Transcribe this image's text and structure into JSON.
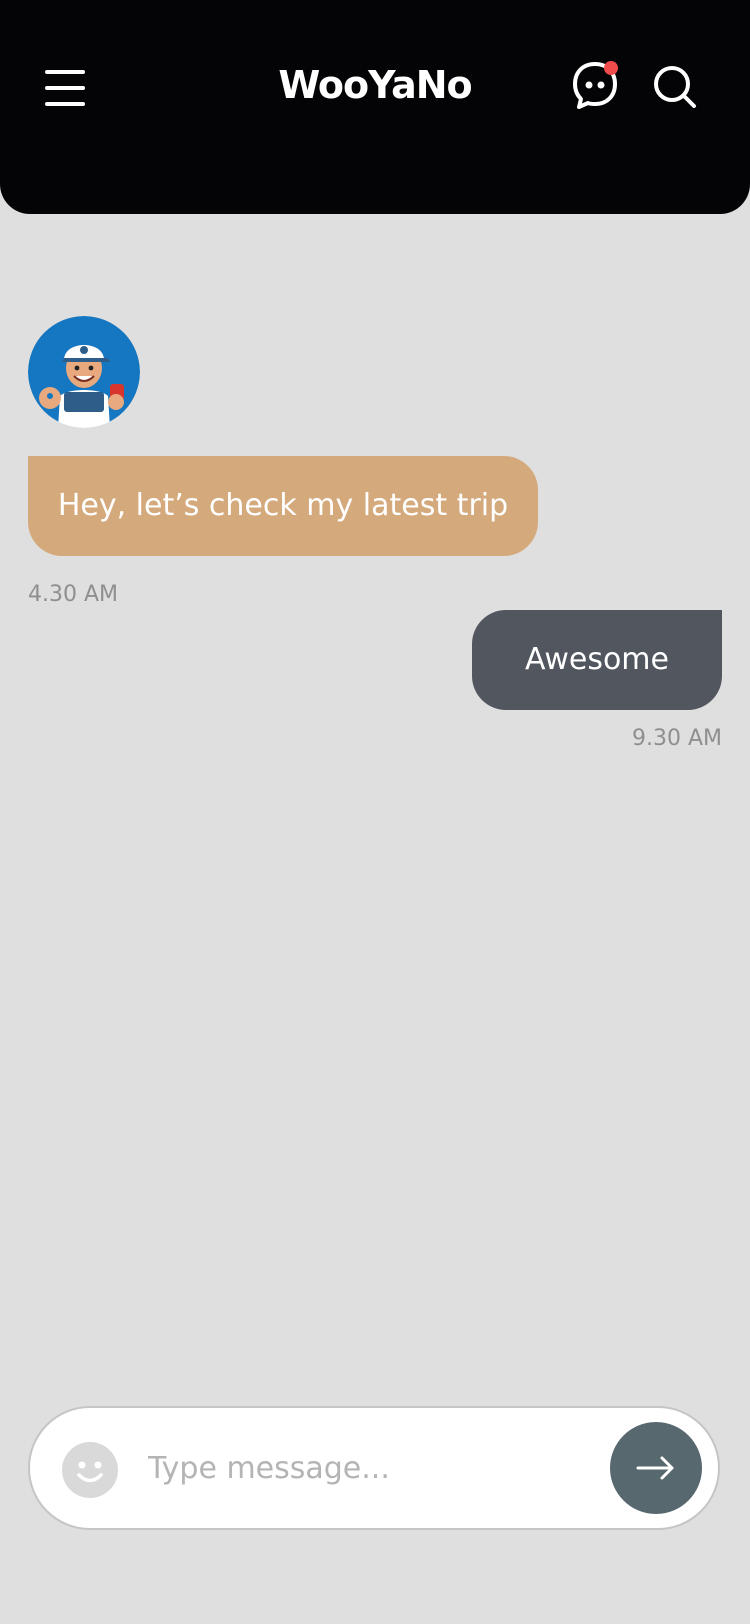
{
  "header": {
    "logo_text": "WooYaNo"
  },
  "icons": {
    "menu": "menu-icon",
    "chat": "chat-bubble-icon",
    "search": "search-icon",
    "emoji": "smiley-icon",
    "send": "arrow-right-icon"
  },
  "colors": {
    "header_bg": "#040406",
    "page_bg": "#dfdfdf",
    "incoming_bubble": "#d4aa7d",
    "outgoing_bubble": "#52565e",
    "notification_dot": "#f24b4b",
    "send_button": "#57686f",
    "avatar_bg": "#1577c2"
  },
  "messages": [
    {
      "direction": "incoming",
      "text": "Hey, let’s check my latest trip",
      "time": "4.30 AM"
    },
    {
      "direction": "outgoing",
      "text": "Awesome",
      "time": "9.30 AM"
    }
  ],
  "composer": {
    "placeholder": "Type message..."
  }
}
